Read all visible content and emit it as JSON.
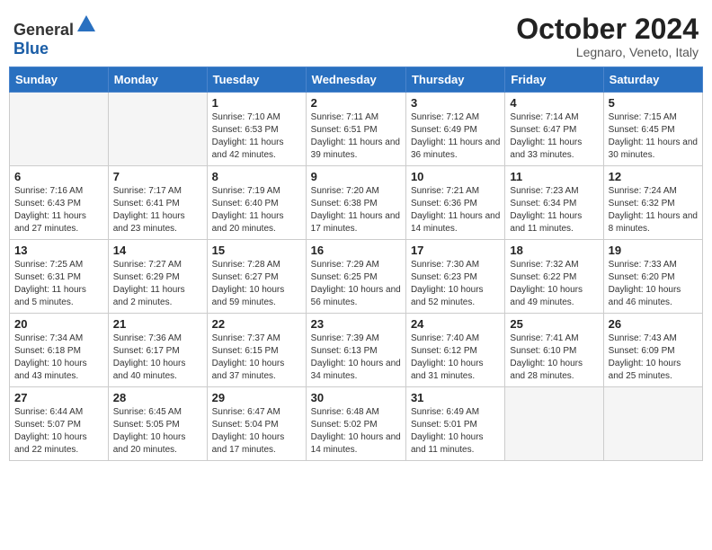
{
  "header": {
    "logo_general": "General",
    "logo_blue": "Blue",
    "month": "October 2024",
    "location": "Legnaro, Veneto, Italy"
  },
  "weekdays": [
    "Sunday",
    "Monday",
    "Tuesday",
    "Wednesday",
    "Thursday",
    "Friday",
    "Saturday"
  ],
  "weeks": [
    [
      {
        "day": "",
        "details": ""
      },
      {
        "day": "",
        "details": ""
      },
      {
        "day": "1",
        "details": "Sunrise: 7:10 AM\nSunset: 6:53 PM\nDaylight: 11 hours and 42 minutes."
      },
      {
        "day": "2",
        "details": "Sunrise: 7:11 AM\nSunset: 6:51 PM\nDaylight: 11 hours and 39 minutes."
      },
      {
        "day": "3",
        "details": "Sunrise: 7:12 AM\nSunset: 6:49 PM\nDaylight: 11 hours and 36 minutes."
      },
      {
        "day": "4",
        "details": "Sunrise: 7:14 AM\nSunset: 6:47 PM\nDaylight: 11 hours and 33 minutes."
      },
      {
        "day": "5",
        "details": "Sunrise: 7:15 AM\nSunset: 6:45 PM\nDaylight: 11 hours and 30 minutes."
      }
    ],
    [
      {
        "day": "6",
        "details": "Sunrise: 7:16 AM\nSunset: 6:43 PM\nDaylight: 11 hours and 27 minutes."
      },
      {
        "day": "7",
        "details": "Sunrise: 7:17 AM\nSunset: 6:41 PM\nDaylight: 11 hours and 23 minutes."
      },
      {
        "day": "8",
        "details": "Sunrise: 7:19 AM\nSunset: 6:40 PM\nDaylight: 11 hours and 20 minutes."
      },
      {
        "day": "9",
        "details": "Sunrise: 7:20 AM\nSunset: 6:38 PM\nDaylight: 11 hours and 17 minutes."
      },
      {
        "day": "10",
        "details": "Sunrise: 7:21 AM\nSunset: 6:36 PM\nDaylight: 11 hours and 14 minutes."
      },
      {
        "day": "11",
        "details": "Sunrise: 7:23 AM\nSunset: 6:34 PM\nDaylight: 11 hours and 11 minutes."
      },
      {
        "day": "12",
        "details": "Sunrise: 7:24 AM\nSunset: 6:32 PM\nDaylight: 11 hours and 8 minutes."
      }
    ],
    [
      {
        "day": "13",
        "details": "Sunrise: 7:25 AM\nSunset: 6:31 PM\nDaylight: 11 hours and 5 minutes."
      },
      {
        "day": "14",
        "details": "Sunrise: 7:27 AM\nSunset: 6:29 PM\nDaylight: 11 hours and 2 minutes."
      },
      {
        "day": "15",
        "details": "Sunrise: 7:28 AM\nSunset: 6:27 PM\nDaylight: 10 hours and 59 minutes."
      },
      {
        "day": "16",
        "details": "Sunrise: 7:29 AM\nSunset: 6:25 PM\nDaylight: 10 hours and 56 minutes."
      },
      {
        "day": "17",
        "details": "Sunrise: 7:30 AM\nSunset: 6:23 PM\nDaylight: 10 hours and 52 minutes."
      },
      {
        "day": "18",
        "details": "Sunrise: 7:32 AM\nSunset: 6:22 PM\nDaylight: 10 hours and 49 minutes."
      },
      {
        "day": "19",
        "details": "Sunrise: 7:33 AM\nSunset: 6:20 PM\nDaylight: 10 hours and 46 minutes."
      }
    ],
    [
      {
        "day": "20",
        "details": "Sunrise: 7:34 AM\nSunset: 6:18 PM\nDaylight: 10 hours and 43 minutes."
      },
      {
        "day": "21",
        "details": "Sunrise: 7:36 AM\nSunset: 6:17 PM\nDaylight: 10 hours and 40 minutes."
      },
      {
        "day": "22",
        "details": "Sunrise: 7:37 AM\nSunset: 6:15 PM\nDaylight: 10 hours and 37 minutes."
      },
      {
        "day": "23",
        "details": "Sunrise: 7:39 AM\nSunset: 6:13 PM\nDaylight: 10 hours and 34 minutes."
      },
      {
        "day": "24",
        "details": "Sunrise: 7:40 AM\nSunset: 6:12 PM\nDaylight: 10 hours and 31 minutes."
      },
      {
        "day": "25",
        "details": "Sunrise: 7:41 AM\nSunset: 6:10 PM\nDaylight: 10 hours and 28 minutes."
      },
      {
        "day": "26",
        "details": "Sunrise: 7:43 AM\nSunset: 6:09 PM\nDaylight: 10 hours and 25 minutes."
      }
    ],
    [
      {
        "day": "27",
        "details": "Sunrise: 6:44 AM\nSunset: 5:07 PM\nDaylight: 10 hours and 22 minutes."
      },
      {
        "day": "28",
        "details": "Sunrise: 6:45 AM\nSunset: 5:05 PM\nDaylight: 10 hours and 20 minutes."
      },
      {
        "day": "29",
        "details": "Sunrise: 6:47 AM\nSunset: 5:04 PM\nDaylight: 10 hours and 17 minutes."
      },
      {
        "day": "30",
        "details": "Sunrise: 6:48 AM\nSunset: 5:02 PM\nDaylight: 10 hours and 14 minutes."
      },
      {
        "day": "31",
        "details": "Sunrise: 6:49 AM\nSunset: 5:01 PM\nDaylight: 10 hours and 11 minutes."
      },
      {
        "day": "",
        "details": ""
      },
      {
        "day": "",
        "details": ""
      }
    ]
  ]
}
